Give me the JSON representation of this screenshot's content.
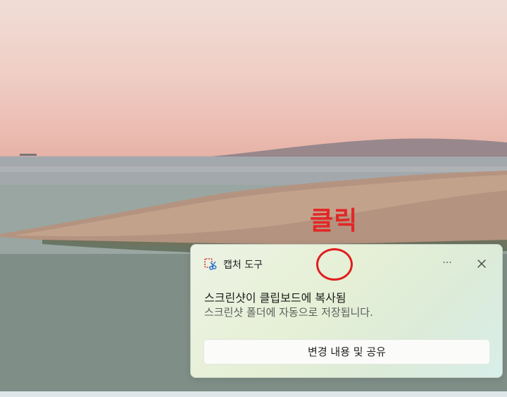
{
  "annotation": {
    "label": "클릭",
    "color": "#e32626"
  },
  "toast": {
    "app_icon": "snipping-tool-icon",
    "app_name": "캡처 도구",
    "more_label": "···",
    "close_icon": "close-icon",
    "title": "스크린샷이 클립보드에 복사됨",
    "body": "스크린샷 폴더에 자동으로 저장됩니다.",
    "action_label": "변경 내용 및 공유"
  }
}
